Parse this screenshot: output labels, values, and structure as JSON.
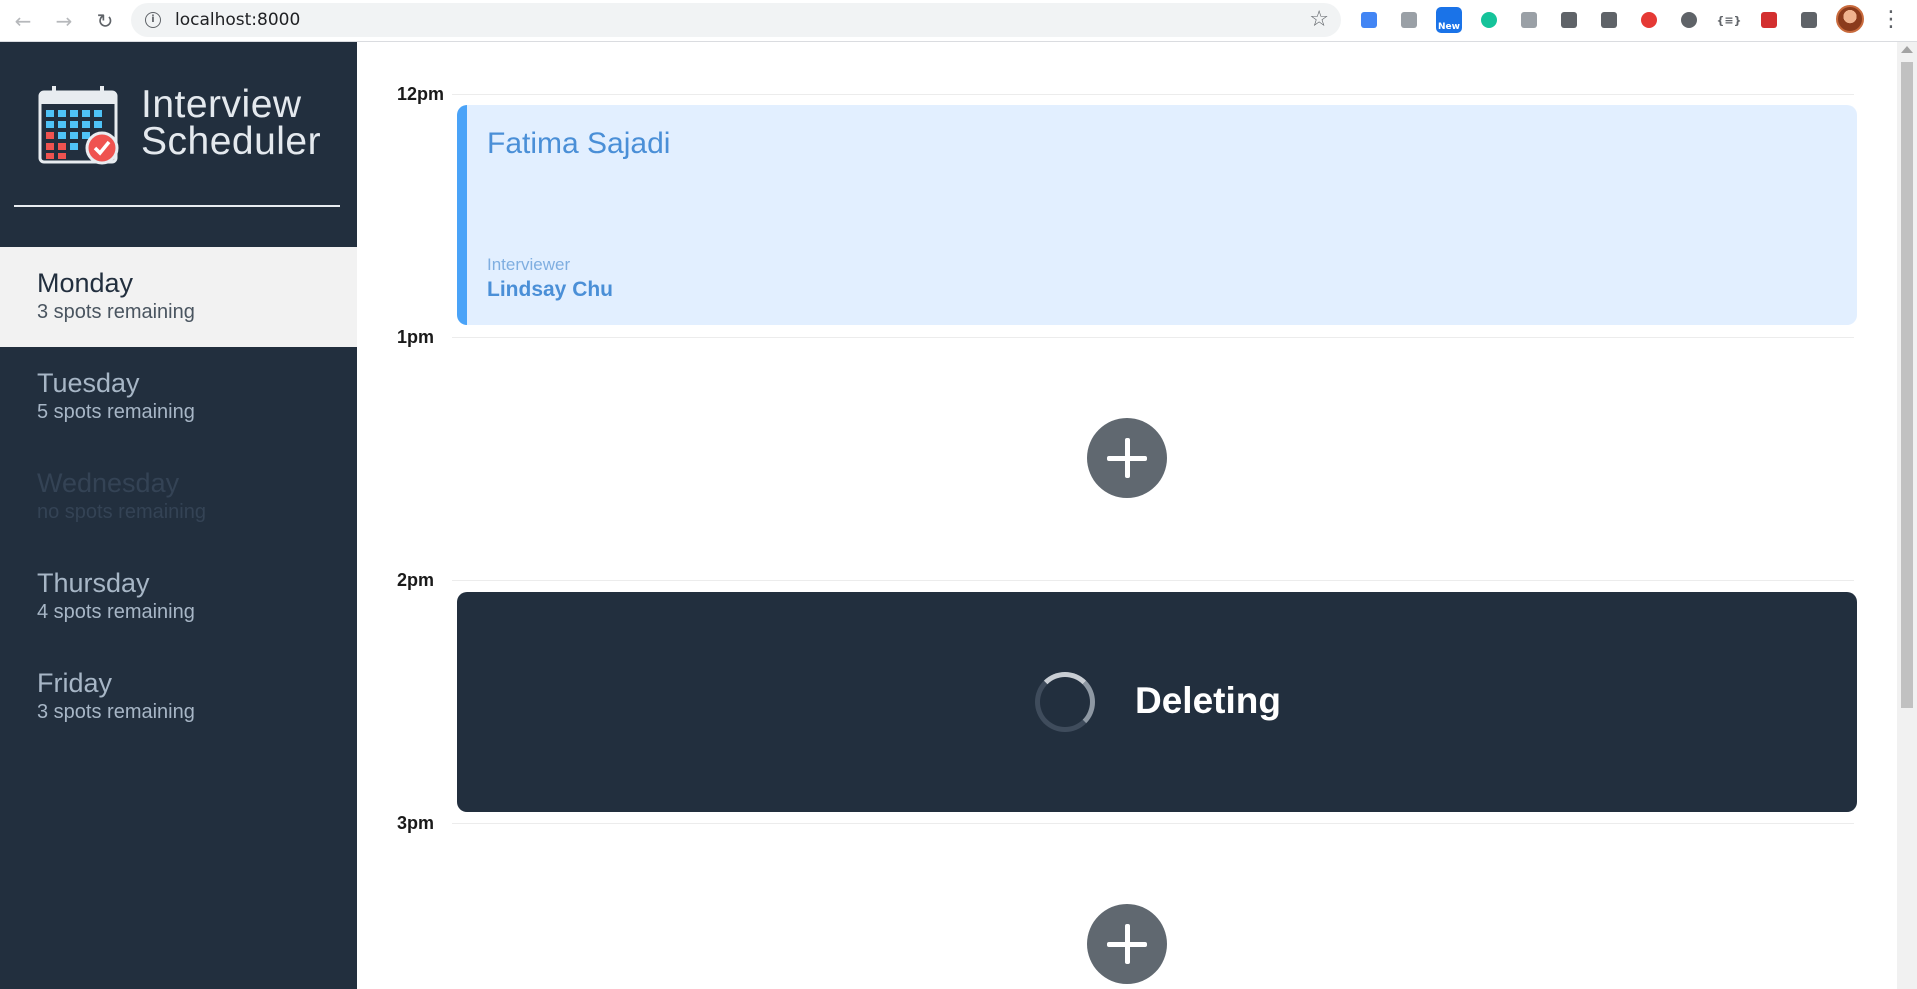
{
  "browser": {
    "url": "localhost:8000",
    "extensions": [
      {
        "icon": "google-translate-icon",
        "color": "#4285f4"
      },
      {
        "icon": "honey-icon",
        "color": "#9aa0a6"
      },
      {
        "icon": "new-badge-icon",
        "color": "#1a73e8",
        "badge": "New"
      },
      {
        "icon": "grammarly-icon",
        "color": "#15c39a"
      },
      {
        "icon": "camera-icon",
        "color": "#9aa0a6"
      },
      {
        "icon": "eyedropper-icon",
        "color": "#5f6368"
      },
      {
        "icon": "zoom-icon",
        "color": "#5f6368"
      },
      {
        "icon": "record-icon",
        "color": "#e53935"
      },
      {
        "icon": "circle-icon",
        "color": "#5f6368"
      },
      {
        "icon": "json-icon",
        "color": "#5f6368",
        "label": "{≡}"
      },
      {
        "icon": "red-extension-icon",
        "color": "#d32f2f"
      },
      {
        "icon": "puzzle-icon",
        "color": "#5f6368"
      }
    ]
  },
  "sidebar": {
    "brand_line1": "Interview",
    "brand_line2": "Scheduler",
    "days": [
      {
        "name": "Monday",
        "spots": "3 spots remaining",
        "state": "selected"
      },
      {
        "name": "Tuesday",
        "spots": "5 spots remaining",
        "state": "normal"
      },
      {
        "name": "Wednesday",
        "spots": "no spots remaining",
        "state": "full"
      },
      {
        "name": "Thursday",
        "spots": "4 spots remaining",
        "state": "normal"
      },
      {
        "name": "Friday",
        "spots": "3 spots remaining",
        "state": "normal"
      }
    ]
  },
  "schedule": {
    "times": [
      "12pm",
      "1pm",
      "2pm",
      "3pm"
    ],
    "booked": {
      "student": "Fatima Sajadi",
      "interviewer_label": "Interviewer",
      "interviewer_name": "Lindsay Chu"
    },
    "deleting": {
      "status": "Deleting"
    }
  },
  "colors": {
    "sidebar_bg": "#222f3e",
    "booked_bg": "#e2efff",
    "booked_accent": "#4aa3f8",
    "add_button": "#606870"
  }
}
